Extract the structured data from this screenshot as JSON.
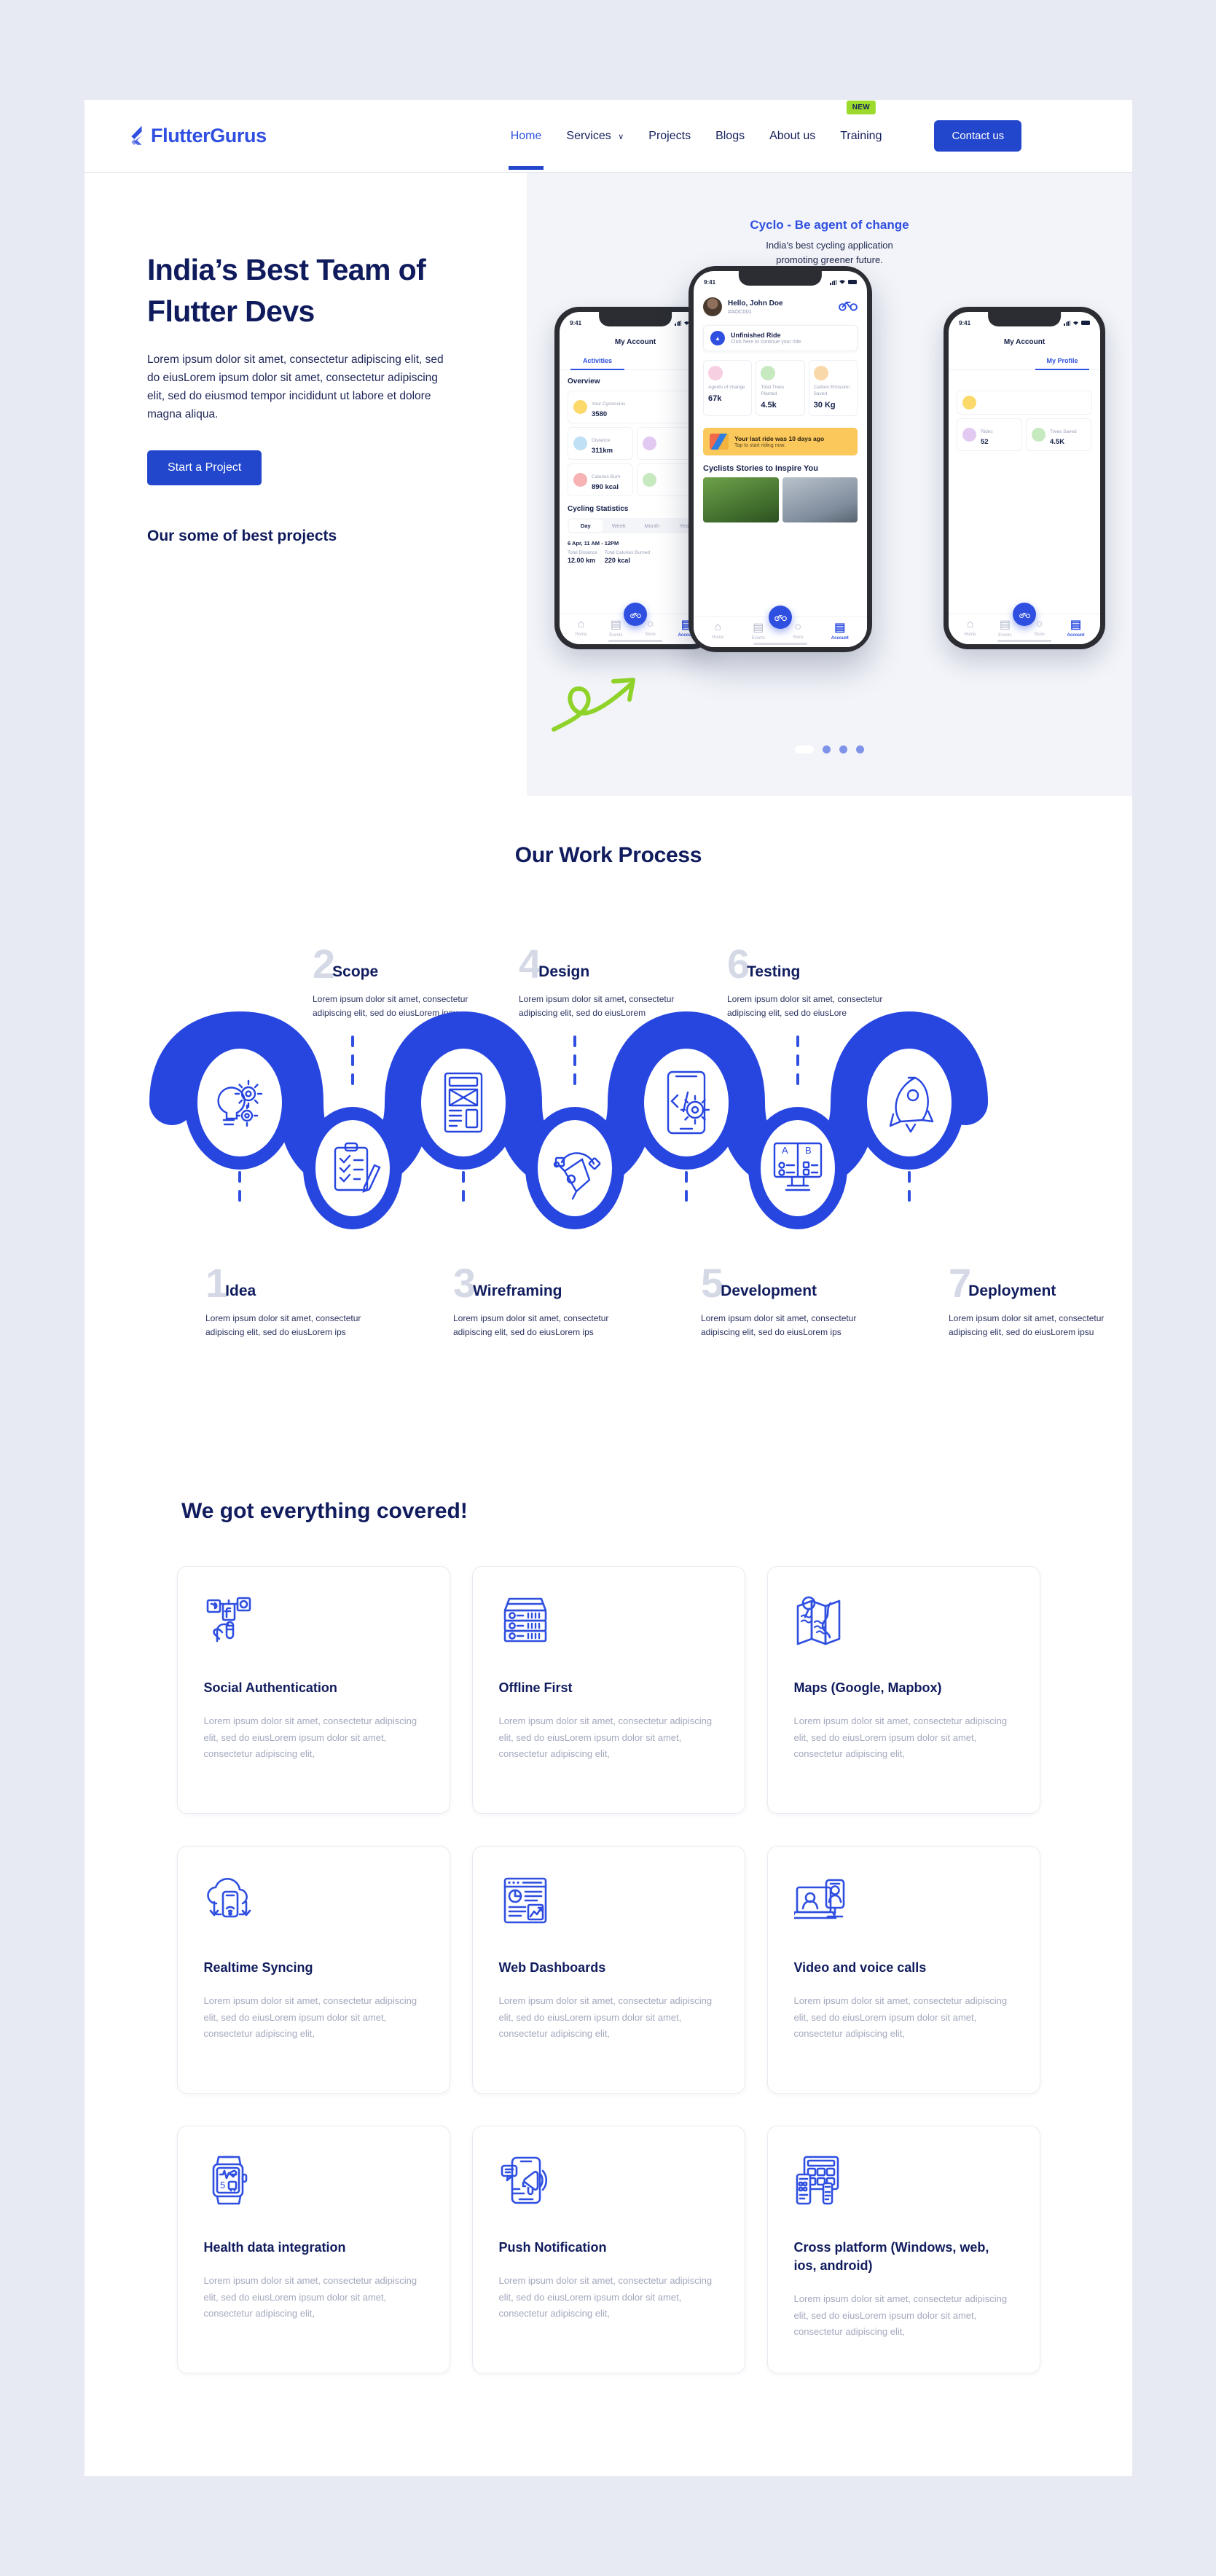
{
  "nav": {
    "brand": "FlutterGurus",
    "links": [
      {
        "label": "Home",
        "active": true
      },
      {
        "label": "Services",
        "caret": "∨"
      },
      {
        "label": "Projects"
      },
      {
        "label": "Blogs"
      },
      {
        "label": "About us"
      },
      {
        "label": "Training",
        "badge": "NEW"
      }
    ],
    "cta": "Contact us"
  },
  "hero": {
    "title_line1": "India’s Best Team of",
    "title_line2": "Flutter Devs",
    "paragraph": "Lorem ipsum dolor sit amet, consectetur adipiscing elit, sed do eiusLorem ipsum dolor sit amet, consectetur adipiscing elit, sed do eiusmod tempor incididunt ut labore et dolore magna aliqua.",
    "cta": "Start a Project",
    "projects_label": "Our some of best projects",
    "showcase_title": "Cyclo - Be agent of change",
    "showcase_sub_line1": "India's best cycling application",
    "showcase_sub_line2": "promoting greener future.",
    "dots": 4,
    "active_dot": 0
  },
  "phone_center": {
    "time": "9:41",
    "greeting": "Hello, John Doe",
    "user_id": "#AOC001",
    "unfinished_title": "Unfinished Ride",
    "unfinished_sub": "Click here to continue your ride",
    "stats": [
      {
        "label": "Agents of change",
        "value": "67k",
        "color": "#f6cfe0"
      },
      {
        "label": "Total Trees Planted",
        "value": "4.5k",
        "color": "#c7e9c0"
      },
      {
        "label": "Carbon Emission Saved",
        "value": "30 Kg",
        "color": "#f8d8a8"
      }
    ],
    "banner_title": "Your last ride was 10 days ago",
    "banner_sub": "Tap to start riding now.",
    "stories_title": "Cyclists Stories to Inspire You",
    "tabs": [
      "Home",
      "Events",
      "Store",
      "Account"
    ],
    "active_tab": "Account"
  },
  "phone_left": {
    "time": "9:41",
    "title": "My Account",
    "tab_active": "Activities",
    "section": "Overview",
    "cards": [
      {
        "label": "Your Cyclocoins",
        "value": "3580",
        "color": "#fbd96b"
      },
      {
        "label": "Distance",
        "value": "311km",
        "color": "#bfe0f5"
      },
      {
        "label": "Calories Burn",
        "value": "890 kcal",
        "color": "#f7b3b3"
      }
    ],
    "stats_title": "Cycling Statistics",
    "segments": [
      "Day",
      "Week",
      "Month",
      "Year"
    ],
    "segment_active": "Day",
    "range": "6 Apr, 11 AM - 12PM",
    "totals": [
      {
        "label": "Total Distance",
        "value": "12.00 km"
      },
      {
        "label": "Total Calories Burned",
        "value": "220 kcal"
      }
    ]
  },
  "phone_right": {
    "title": "My Account",
    "tab_active": "My Profile",
    "cards": [
      {
        "label": "Rides",
        "value": "52",
        "color": "#e2c9f2"
      },
      {
        "label": "Trees Saved",
        "value": "4.5K",
        "color": "#c7e9c0"
      }
    ]
  },
  "process": {
    "title": "Our Work Process",
    "steps_top": [
      {
        "num": "2",
        "name": "Scope",
        "desc": "Lorem ipsum dolor sit amet, consectetur adipiscing elit, sed do eiusLorem ipsu"
      },
      {
        "num": "4",
        "name": "Design",
        "desc": "Lorem ipsum dolor sit amet, consectetur adipiscing elit, sed do eiusLorem"
      },
      {
        "num": "6",
        "name": "Testing",
        "desc": "Lorem ipsum dolor sit amet, consectetur adipiscing elit, sed do eiusLore"
      }
    ],
    "steps_bottom": [
      {
        "num": "1",
        "name": "Idea",
        "desc": "Lorem ipsum dolor sit amet, consectetur adipiscing elit, sed do eiusLorem ips"
      },
      {
        "num": "3",
        "name": "Wireframing",
        "desc": "Lorem ipsum dolor sit amet, consectetur adipiscing elit, sed do eiusLorem ips"
      },
      {
        "num": "5",
        "name": "Development",
        "desc": "Lorem ipsum dolor sit amet, consectetur adipiscing elit, sed do eiusLorem ips"
      },
      {
        "num": "7",
        "name": "Deployment",
        "desc": "Lorem ipsum dolor sit amet, consectetur adipiscing elit, sed do eiusLorem ipsu"
      }
    ]
  },
  "features": {
    "title": "We got everything covered!",
    "common_desc": "Lorem ipsum dolor sit amet, consectetur adipiscing elit, sed do eiusLorem ipsum dolor sit amet, consectetur adipiscing elit,",
    "cards": [
      {
        "icon": "social-authentication-icon",
        "title": "Social Authentication"
      },
      {
        "icon": "server-stack-icon",
        "title": "Offline First"
      },
      {
        "icon": "map-pin-icon",
        "title": "Maps (Google, Mapbox)"
      },
      {
        "icon": "cloud-sync-icon",
        "title": "Realtime Syncing"
      },
      {
        "icon": "dashboard-icon",
        "title": "Web Dashboards"
      },
      {
        "icon": "video-call-icon",
        "title": "Video and voice calls"
      },
      {
        "icon": "smartwatch-icon",
        "title": "Health data integration"
      },
      {
        "icon": "push-notification-icon",
        "title": "Push Notification"
      },
      {
        "icon": "cross-platform-icon",
        "title": "Cross platform (Windows, web, ios, android)"
      }
    ]
  },
  "colors": {
    "brand_blue": "#2246cc",
    "accent_blue": "#2f4fe0",
    "navy": "#101c5e",
    "badge_green": "#9cdb2b",
    "page_bg": "#e7eaf3",
    "panel_bg": "#f2f4f9"
  }
}
